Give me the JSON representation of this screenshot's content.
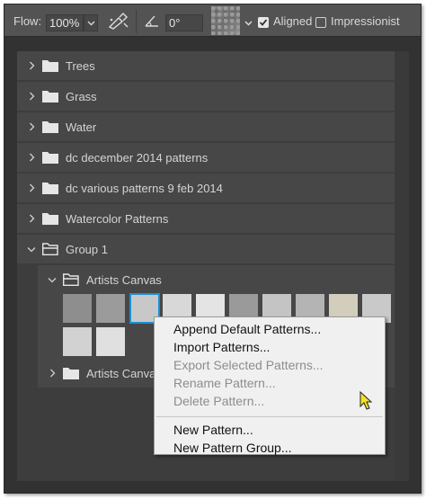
{
  "toolbar": {
    "flow_label": "Flow:",
    "flow_value": "100%",
    "angle_value": "0°",
    "aligned_label": "Aligned",
    "aligned_checked": true,
    "impressionist_label": "Impressionist",
    "impressionist_checked": false,
    "icons": [
      "airbrush-icon",
      "angle-icon",
      "pattern-swatch",
      "chevron-down-icon"
    ]
  },
  "tree": {
    "folders": [
      {
        "label": "Trees",
        "expanded": false
      },
      {
        "label": "Grass",
        "expanded": false
      },
      {
        "label": "Water",
        "expanded": false
      },
      {
        "label": "dc december 2014 patterns",
        "expanded": false
      },
      {
        "label": "dc various patterns 9 feb 2014",
        "expanded": false
      },
      {
        "label": "Watercolor Patterns",
        "expanded": false
      },
      {
        "label": "Group 1",
        "expanded": true
      }
    ],
    "subfolders": [
      {
        "label": "Artists Canvas",
        "expanded": true
      },
      {
        "label": "Artists Canvas",
        "expanded": false
      }
    ],
    "pattern_colors": [
      "#8e8e8e",
      "#9b9b9b",
      "#c8c8c8",
      "#d8d8d8",
      "#e4e4e4",
      "#9a9a9a",
      "#c4c4c4",
      "#b4b4b4",
      "#d3cebb",
      "#c9c9c9",
      "#d2d2d2",
      "#e0e0e0"
    ],
    "selected_pattern_index": 2
  },
  "context_menu": {
    "items": [
      {
        "label": "Append Default Patterns...",
        "enabled": true
      },
      {
        "label": "Import Patterns...",
        "enabled": true
      },
      {
        "label": "Export Selected Patterns...",
        "enabled": false
      },
      {
        "label": "Rename Pattern...",
        "enabled": false
      },
      {
        "label": "Delete Pattern...",
        "enabled": false
      },
      {
        "label": "New Pattern...",
        "enabled": true
      },
      {
        "label": "New Pattern Group...",
        "enabled": true
      }
    ]
  }
}
